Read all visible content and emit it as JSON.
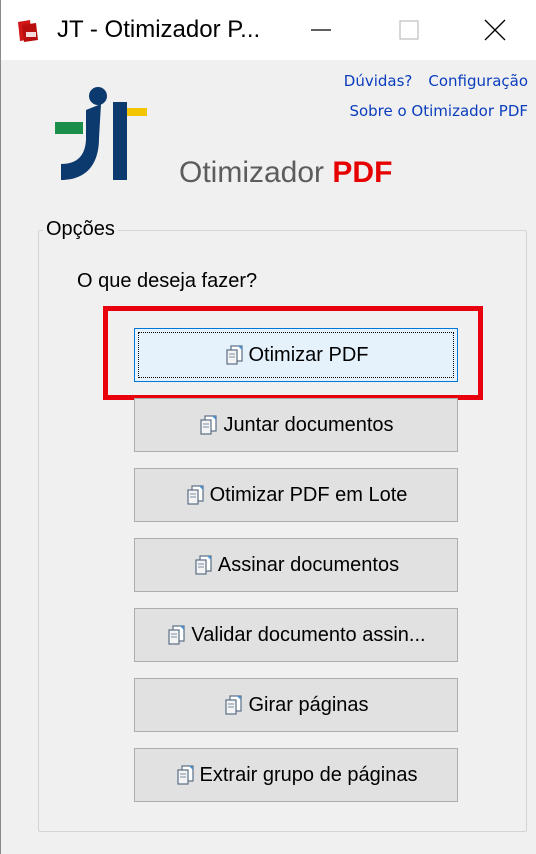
{
  "window": {
    "title": "JT - Otimizador P...",
    "icon": "pdf-app-icon"
  },
  "links": {
    "help": "Dúvidas?",
    "settings": "Configuração",
    "about": "Sobre o Otimizador PDF"
  },
  "header": {
    "app_name_prefix": "Otimizador",
    "app_name_suffix": "PDF"
  },
  "options": {
    "group_title": "Opções",
    "question": "O que deseja fazer?",
    "buttons": [
      {
        "label": "Otimizar PDF"
      },
      {
        "label": "Juntar documentos"
      },
      {
        "label": "Otimizar PDF em Lote"
      },
      {
        "label": "Assinar documentos"
      },
      {
        "label": "Validar documento assin..."
      },
      {
        "label": "Girar páginas"
      },
      {
        "label": "Extrair grupo de páginas"
      }
    ]
  },
  "colors": {
    "accent_red": "#e60000",
    "link_blue": "#0a3dbd",
    "logo_navy": "#0d3a6e",
    "logo_green": "#1a8f4a",
    "logo_yellow": "#f2c500",
    "highlight_red": "#e8000d"
  }
}
